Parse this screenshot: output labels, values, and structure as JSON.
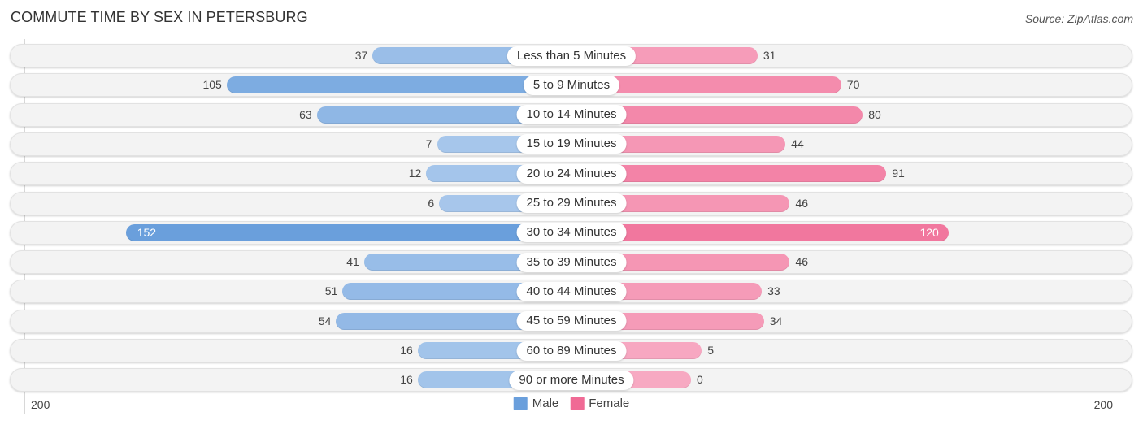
{
  "header": {
    "title": "COMMUTE TIME BY SEX IN PETERSBURG",
    "source": "Source: ZipAtlas.com"
  },
  "colors": {
    "male_strong": "#6a9fdc",
    "male_light": "#a9c8ec",
    "female_strong": "#f06a95",
    "female_light": "#f7a9c2",
    "track": "#f3f3f3"
  },
  "chart_data": {
    "type": "bar",
    "orientation": "horizontal-diverging",
    "title": "COMMUTE TIME BY SEX IN PETERSBURG",
    "categories": [
      "Less than 5 Minutes",
      "5 to 9 Minutes",
      "10 to 14 Minutes",
      "15 to 19 Minutes",
      "20 to 24 Minutes",
      "25 to 29 Minutes",
      "30 to 34 Minutes",
      "35 to 39 Minutes",
      "40 to 44 Minutes",
      "45 to 59 Minutes",
      "60 to 89 Minutes",
      "90 or more Minutes"
    ],
    "series": [
      {
        "name": "Male",
        "values": [
          37,
          105,
          63,
          7,
          12,
          6,
          152,
          41,
          51,
          54,
          16,
          16
        ]
      },
      {
        "name": "Female",
        "values": [
          31,
          70,
          80,
          44,
          91,
          46,
          120,
          46,
          33,
          34,
          5,
          0
        ]
      }
    ],
    "axis": {
      "left_label": "200",
      "right_label": "200",
      "range": [
        -200,
        200
      ]
    },
    "legend": {
      "placement": "bottom-center",
      "entries": [
        "Male",
        "Female"
      ]
    },
    "grid": false
  }
}
